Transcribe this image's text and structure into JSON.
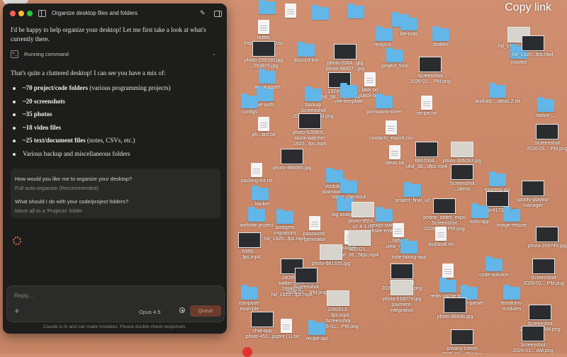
{
  "window": {
    "title": "Organize desktop files and folders",
    "traffic_lights": [
      "#ff5f57",
      "#febc2e",
      "#28c840"
    ]
  },
  "chat": {
    "intro": "I'd be happy to help organize your desktop! Let me first take a look at what's currently there.",
    "tool_label": "Running command",
    "lead": "That's quite a cluttered desktop! I can see you have a mix of:",
    "bullets": [
      {
        "bold": "~70 project/code folders",
        "rest": " (various programming projects)"
      },
      {
        "bold": "~20 screenshots",
        "rest": ""
      },
      {
        "bold": "~35 photos",
        "rest": ""
      },
      {
        "bold": "~18 video files",
        "rest": ""
      },
      {
        "bold": "~25 text/document files",
        "rest": " (notes, CSVs, etc.)"
      },
      {
        "bold": "",
        "rest": "Various backup and miscellaneous folders"
      }
    ],
    "questions": [
      {
        "question": "How would you like me to organize your desktop?",
        "answer": "Full auto-organize (Recommended)"
      },
      {
        "question": "What should I do with your code/project folders?",
        "answer": "Move all to a 'Projects' folder"
      }
    ]
  },
  "composer": {
    "placeholder": "Reply...",
    "model": "Opus 4.5",
    "queue_label": "Queue"
  },
  "footer": "Claude is AI and can make mistakes. Please double-check responses.",
  "overlay": {
    "copy_link": "Copy link"
  },
  "desktop_icons": [
    {
      "label": "",
      "kind": "folder"
    },
    {
      "label": "",
      "kind": "doc"
    },
    {
      "label": "",
      "kind": "folder"
    },
    {
      "label": "",
      "kind": "folder"
    },
    {
      "label": "",
      "kind": "folder"
    },
    {
      "label": "hd_1920...fps.mp4",
      "kind": "thumb"
    },
    {
      "label": "twitter\nexpenses_oct.csv",
      "kind": "doc"
    },
    {
      "label": "nextjs-a...",
      "kind": "folder"
    },
    {
      "label": "lite-todo",
      "kind": "folder"
    },
    {
      "label": "dotfiles",
      "kind": "folder"
    },
    {
      "label": "movies",
      "kind": "folder"
    },
    {
      "label": "hd_1920...fps.mp4",
      "kind": "thumb"
    },
    {
      "label": "photo-256150.jpg\n...253879.jpg",
      "kind": "thumb"
    },
    {
      "label": "discord-bot",
      "kind": "folder"
    },
    {
      "label": "photo-2064...jpg\nphoto-46007...jpg",
      "kind": "thumb"
    },
    {
      "label": "project_final",
      "kind": "folder"
    },
    {
      "label": "Screenshot\n2026-01... PM.png",
      "kind": "thumb"
    },
    {
      "label": "api-wrapper",
      "kind": "folder"
    },
    {
      "label": "jwt-auth",
      "kind": "folder"
    },
    {
      "label": "configs",
      "kind": "folder"
    },
    {
      "label": "1324936...\nuhd_38...4fps.mp4",
      "kind": "thumb"
    },
    {
      "label": "later.txt\nslack-bot",
      "kind": "doc"
    },
    {
      "label": "vite-template",
      "kind": "folder"
    },
    {
      "label": "backup\nScreenshot\n2026-01... PM.png",
      "kind": "folder"
    },
    {
      "label": "pomodoro-timer",
      "kind": "folder"
    },
    {
      "label": "recipe.txt",
      "kind": "doc"
    },
    {
      "label": "android-...ideas 2.txt",
      "kind": "folder"
    },
    {
      "label": "notion-...",
      "kind": "folder"
    },
    {
      "label": "Screenshot\n2026-01... PM.png",
      "kind": "thumb"
    },
    {
      "label": "ph...ard.txt",
      "kind": "doc"
    },
    {
      "label": "photo-526909...\nstock-watcher 1920...fps.mp4",
      "kind": "thumb"
    },
    {
      "label": "contacts_export.csv",
      "kind": "doc"
    },
    {
      "label": "6667004...\nuhd_38...0fps.mp4",
      "kind": "thumb"
    },
    {
      "label": "photo-306283.jpg",
      "kind": "thumb"
    },
    {
      "label": "photo-466685.jpg",
      "kind": "thumb"
    },
    {
      "label": "ideas.txt",
      "kind": "doc"
    },
    {
      "label": "packing-list.txt",
      "kind": "doc"
    },
    {
      "label": "youtube-\ndownloader",
      "kind": "folder"
    },
    {
      "label": "Screenshot\n...demo",
      "kind": "thumb"
    },
    {
      "label": "express-api",
      "kind": "folder"
    },
    {
      "label": "spotify-playlist-\nmanager",
      "kind": "thumb"
    },
    {
      "label": "stripe-checkout",
      "kind": "folder"
    },
    {
      "label": "...hacker",
      "kind": "folder"
    },
    {
      "label": "project_final_v2",
      "kind": "folder"
    },
    {
      "label": "photo-417344.jpg",
      "kind": "thumb"
    },
    {
      "label": "log-analyzer",
      "kind": "folder"
    },
    {
      "label": "phone_notes_expo\nScreenshot\n2026-01... PM.png",
      "kind": "thumb"
    },
    {
      "label": "todo-app",
      "kind": "folder"
    },
    {
      "label": "website project",
      "kind": "folder"
    },
    {
      "label": "photo-9551...\nv2-4-1.txt",
      "kind": "thumb"
    },
    {
      "label": "postgres\nmigrations\nhd_1920...fps.mp4",
      "kind": "folder"
    },
    {
      "label": "password-\ngenerator",
      "kind": "doc"
    },
    {
      "label": "nextjs-starter\nwebsite-redesign",
      "kind": "folder"
    },
    {
      "label": "image-resizer",
      "kind": "folder"
    },
    {
      "label": "photo-209745.jpg",
      "kind": "thumb"
    },
    {
      "label": "6989...\n...fps.mp4",
      "kind": "thumb"
    },
    {
      "label": "budget...",
      "kind": "doc"
    },
    {
      "label": "882021...\nhd_38...5fps.mp4",
      "kind": "thumb"
    },
    {
      "label": "...085481\n...view_map.txt",
      "kind": "doc"
    },
    {
      "label": "asdfasdf.txt",
      "kind": "doc"
    },
    {
      "label": "note-taking-app",
      "kind": "folder"
    },
    {
      "label": "photo-681335.jpg",
      "kind": "thumb"
    },
    {
      "label": "Screenshot\n2026-01... PM.png",
      "kind": "thumb"
    },
    {
      "label": "160994...\ntwitter-clone\n1994828-\nhd_1920...fps.mp4",
      "kind": "thumb"
    },
    {
      "label": "Screenshot\n2026-01... PM.png",
      "kind": "thumb"
    },
    {
      "label": "...ml",
      "kind": "doc"
    },
    {
      "label": "code-solution",
      "kind": "folder"
    },
    {
      "label": "Screenshot\n2026-01... PM.png",
      "kind": "thumb"
    },
    {
      "label": "compose-\nexample",
      "kind": "folder"
    },
    {
      "label": "photo-618079.jpg\npayment-\nintegration",
      "kind": "thumb"
    },
    {
      "label": "redis-cache-test",
      "kind": "folder"
    },
    {
      "label": "...own-parser",
      "kind": "folder"
    },
    {
      "label": "terraform-\nmodules",
      "kind": "folder"
    },
    {
      "label": "2282013-\n...fps.mp4\nScreenshot\n2026-01... PM.png",
      "kind": "thumb"
    },
    {
      "label": "photo-66898.jpg",
      "kind": "thumb"
    },
    {
      "label": "Screenshot\n2026-01... AM.png",
      "kind": "thumb"
    },
    {
      "label": "chat-app\nphoto-451...jpg",
      "kind": "thumb"
    },
    {
      "label": "...ent (1).txt",
      "kind": "doc"
    },
    {
      "label": "recipe-api",
      "kind": "folder"
    },
    {
      "label": "privacy-comm\n2026-01... PM.png",
      "kind": "thumb"
    },
    {
      "label": "Screenshot\n2026-01... AM.png",
      "kind": "thumb"
    }
  ]
}
